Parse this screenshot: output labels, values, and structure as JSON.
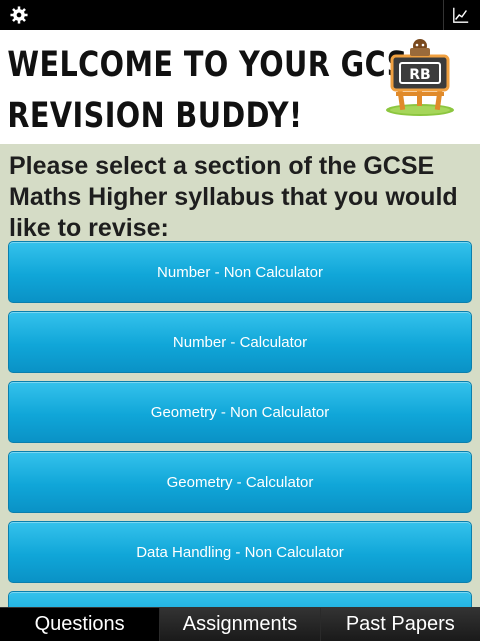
{
  "status_bar": {
    "left_icon": "gear-icon",
    "right_icon": "chart-icon"
  },
  "header": {
    "title_line1": "WELCOME TO YOUR GCSE",
    "title_line2": "REVISION BUDDY!",
    "logo_text": "RB"
  },
  "prompt": "Please select a section of the GCSE Maths Higher syllabus that you would like to revise:",
  "sections": [
    {
      "label": "Number - Non Calculator"
    },
    {
      "label": "Number - Calculator"
    },
    {
      "label": "Geometry - Non Calculator"
    },
    {
      "label": "Geometry - Calculator"
    },
    {
      "label": "Data Handling - Non Calculator"
    },
    {
      "label": ""
    }
  ],
  "tabs": [
    {
      "label": "Questions",
      "active": true
    },
    {
      "label": "Assignments",
      "active": false
    },
    {
      "label": "Past Papers",
      "active": false
    }
  ],
  "colors": {
    "button": "#10a6d8",
    "background": "#d5dcc6",
    "header_bg": "#ffffff",
    "tabbar_bg": "#000000"
  }
}
